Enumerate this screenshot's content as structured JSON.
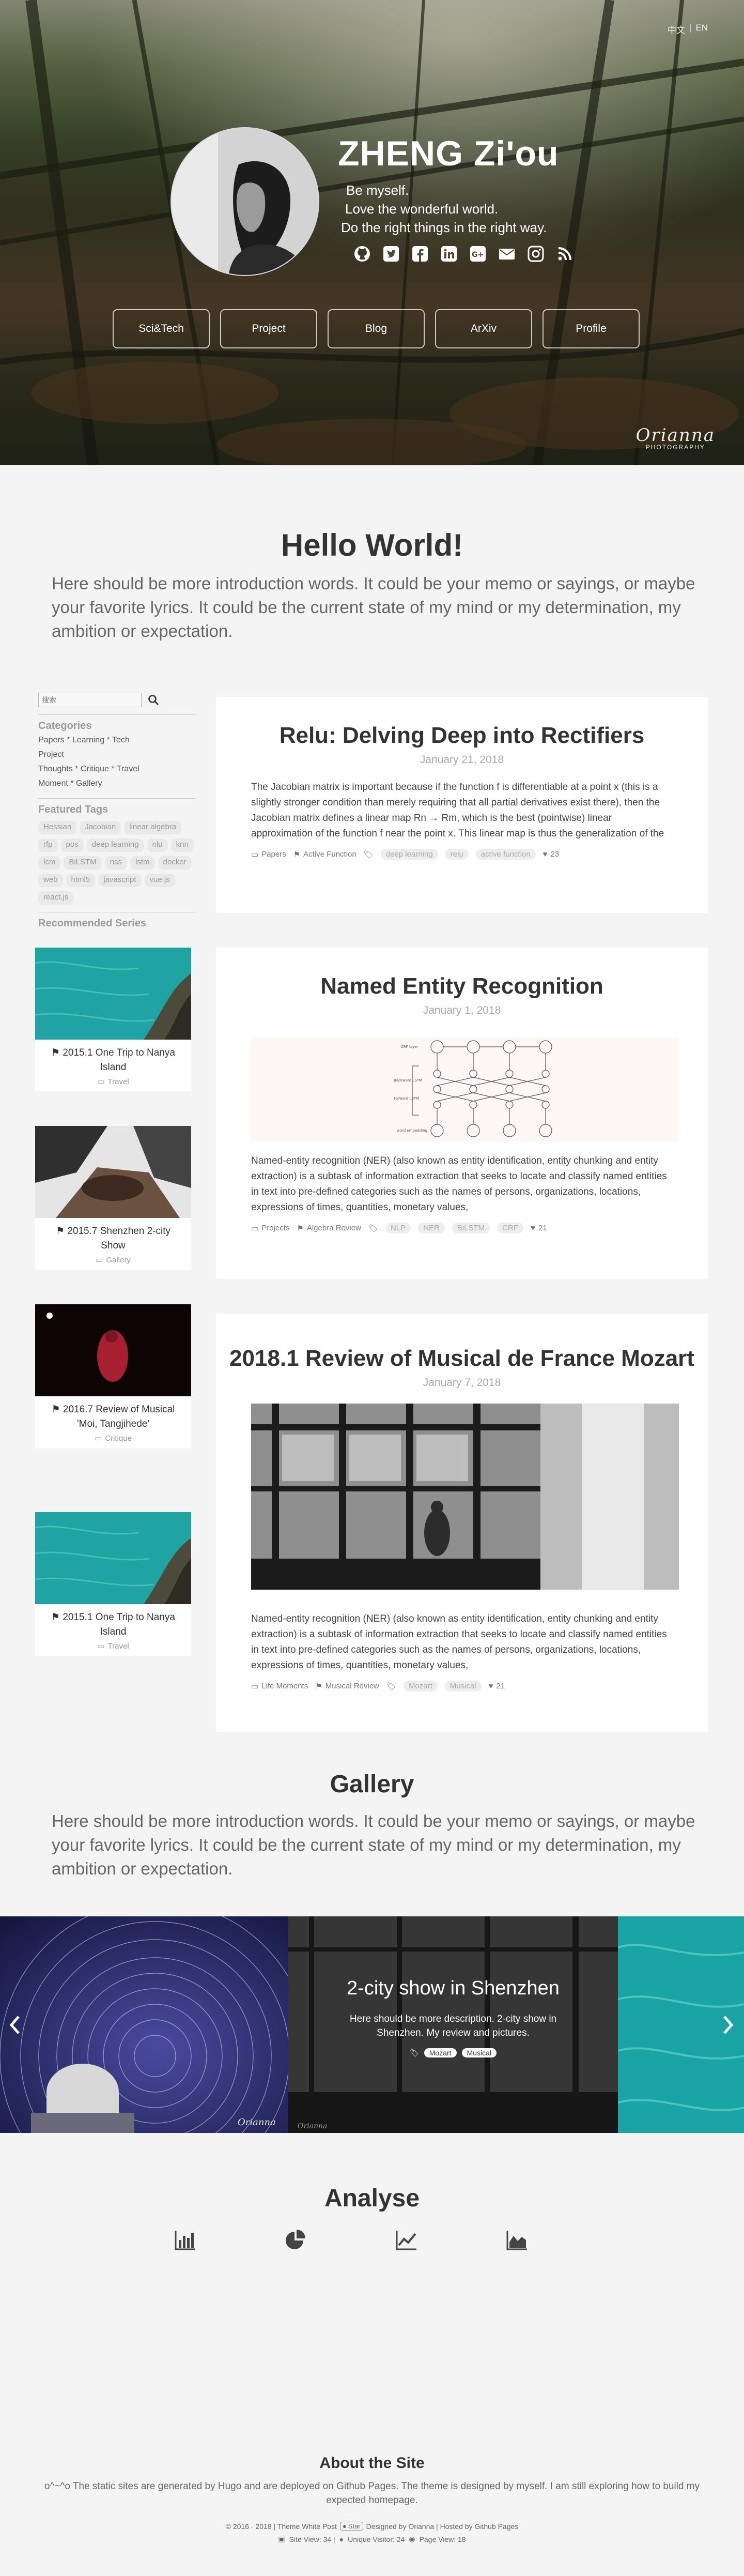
{
  "lang": {
    "zh": "中文",
    "sep": "|",
    "en": "EN"
  },
  "hero": {
    "name": "ZHENG Zi'ou",
    "motto": [
      "Be myself.",
      "Love the wonderful world.",
      "Do the right things in the right way."
    ],
    "social_icons": [
      "github-icon",
      "twitter-icon",
      "facebook-icon",
      "linkedin-icon",
      "google-plus-icon",
      "email-icon",
      "instagram-icon",
      "rss-icon"
    ],
    "nav": [
      "Sci&Tech",
      "Project",
      "Blog",
      "ArXiv",
      "Profile"
    ],
    "watermark": {
      "script": "Orianna",
      "sub": "PHOTOGRAPHY"
    }
  },
  "intro": {
    "title": "Hello World!",
    "text": "Here should be more introduction words. It could be your memo or sayings, or maybe your favorite lyrics. It could be the current state of my mind or my determination, my ambition or expectation."
  },
  "sidebar": {
    "search_placeholder": "搜索",
    "categories_title": "Categories",
    "categories": [
      "Papers * Learning * Tech",
      "Project",
      "Thoughts * Critique * Travel",
      "Moment * Gallery"
    ],
    "tags_title": "Featured Tags",
    "tags": [
      "Hessian",
      "Jacobian",
      "linear algebra",
      "rfp",
      "pos",
      "deep learning",
      "nlu",
      "knn",
      "lcm",
      "BiLSTM",
      "nss",
      "lstm",
      "docker",
      "web",
      "html5",
      "javascript",
      "vue.js",
      "react.js"
    ],
    "recommended_title": "Recommended Series",
    "recommended": [
      {
        "title": "2015.1 One Trip to Nanya Island",
        "category": "Travel"
      },
      {
        "title": "2015.7 Shenzhen 2-city Show",
        "category": "Gallery"
      },
      {
        "title": "2016.7 Review of Musical 'Moi, Tangjihede'",
        "category": "Critique"
      },
      {
        "title": "2015.1 One Trip to Nanya Island",
        "category": "Travel"
      }
    ]
  },
  "posts": [
    {
      "title": "Relu: Delving Deep into Rectifiers",
      "date": "January 21, 2018",
      "excerpt": "The Jacobian matrix is important because if the function f is differentiable at a point x (this is a slightly stronger condition than merely requiring that all partial derivatives exist there), then the Jacobian matrix defines a linear map Rn → Rm, which is the best (pointwise) linear approximation of the function f near the point x. This linear map is thus the generalization of the usual notion of derivative, and is called the derivative or",
      "category": "Papers",
      "series": "Active Function",
      "tags": [
        "deep learning",
        "relu",
        "active function"
      ],
      "likes": "23"
    },
    {
      "title": "Named Entity Recognition",
      "date": "January 1, 2018",
      "excerpt": "Named-entity recognition (NER) (also known as entity identification, entity chunking and entity extraction) is a subtask of information extraction that seeks to locate and classify named entities in text into pre-defined categories such as the names of persons, organizations, locations, expressions of times, quantities, monetary values,",
      "category": "Projects",
      "series": "Algebra Review",
      "tags": [
        "NLP",
        "NER",
        "BiLSTM",
        "CRF"
      ],
      "likes": "21",
      "diagram": {
        "top": "CRF layer",
        "mid_upper": "Backward LSTM",
        "mid_lower": "Forward LSTM",
        "bottom": "word embedding"
      }
    },
    {
      "title": "2018.1 Review of Musical de France Mozart",
      "date": "January 7, 2018",
      "excerpt": "Named-entity recognition (NER) (also known as entity identification, entity chunking and entity extraction) is a subtask of information extraction that seeks to locate and classify named entities in text into pre-defined categories such as the names of persons, organizations, locations, expressions of times, quantities, monetary values,",
      "category": "Life Moments",
      "series": "Musical Review",
      "tags": [
        "Mozart",
        "Musical"
      ],
      "likes": "21"
    }
  ],
  "gallery": {
    "title": "Gallery",
    "text": "Here should be more introduction words. It could be your memo or sayings, or maybe your favorite lyrics. It could be the current state of my mind or my determination, my ambition or expectation.",
    "slide_title": "2-city show in Shenzhen",
    "slide_desc": "Here should be more description. 2-city show in Shenzhen. My review and pictures.",
    "slide_tags": [
      "Mozart",
      "Musical"
    ],
    "left_watermark": "Orianna",
    "center_watermark": "Orianna"
  },
  "analyse": {
    "title": "Analyse",
    "icons": [
      "bar-chart-icon",
      "pie-chart-icon",
      "line-chart-icon",
      "area-chart-icon"
    ]
  },
  "footer": {
    "title": "About the Site",
    "desc": "o^~^o The static sites are generated by Hugo  and are deployed on Github Pages.  The theme is designed by myself. I am still exploring how to build my expected homepage.",
    "copyright": "© 2016 - 2018 | Theme White Post",
    "star": "Star",
    "designed": "Designed by Orianna | Hosted by Github Pages",
    "site_view": "Site View: 34 |",
    "unique_visitor": "Unique Visitor: 24",
    "page_view": "Page View: 18"
  },
  "colors": {
    "background": "#f4f4f4",
    "card": "#ffffff",
    "text": "#333333",
    "muted": "#999999"
  }
}
